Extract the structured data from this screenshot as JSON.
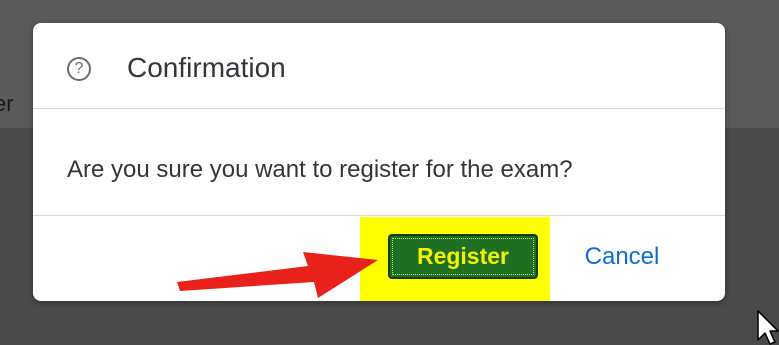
{
  "background": {
    "text_fragment": "er"
  },
  "dialog": {
    "title": "Confirmation",
    "icon": "help-circle-icon",
    "message": "Are you sure you want to register for the exam?",
    "buttons": {
      "register_label": "Register",
      "cancel_label": "Cancel"
    }
  },
  "annotation": {
    "arrow_color": "#e8211a",
    "highlight_color": "#ffff00"
  },
  "colors": {
    "register_bg": "#1e6f22",
    "register_text": "#f5f300",
    "cancel_text": "#0a6ed1",
    "backdrop": "#4a4a4a"
  }
}
